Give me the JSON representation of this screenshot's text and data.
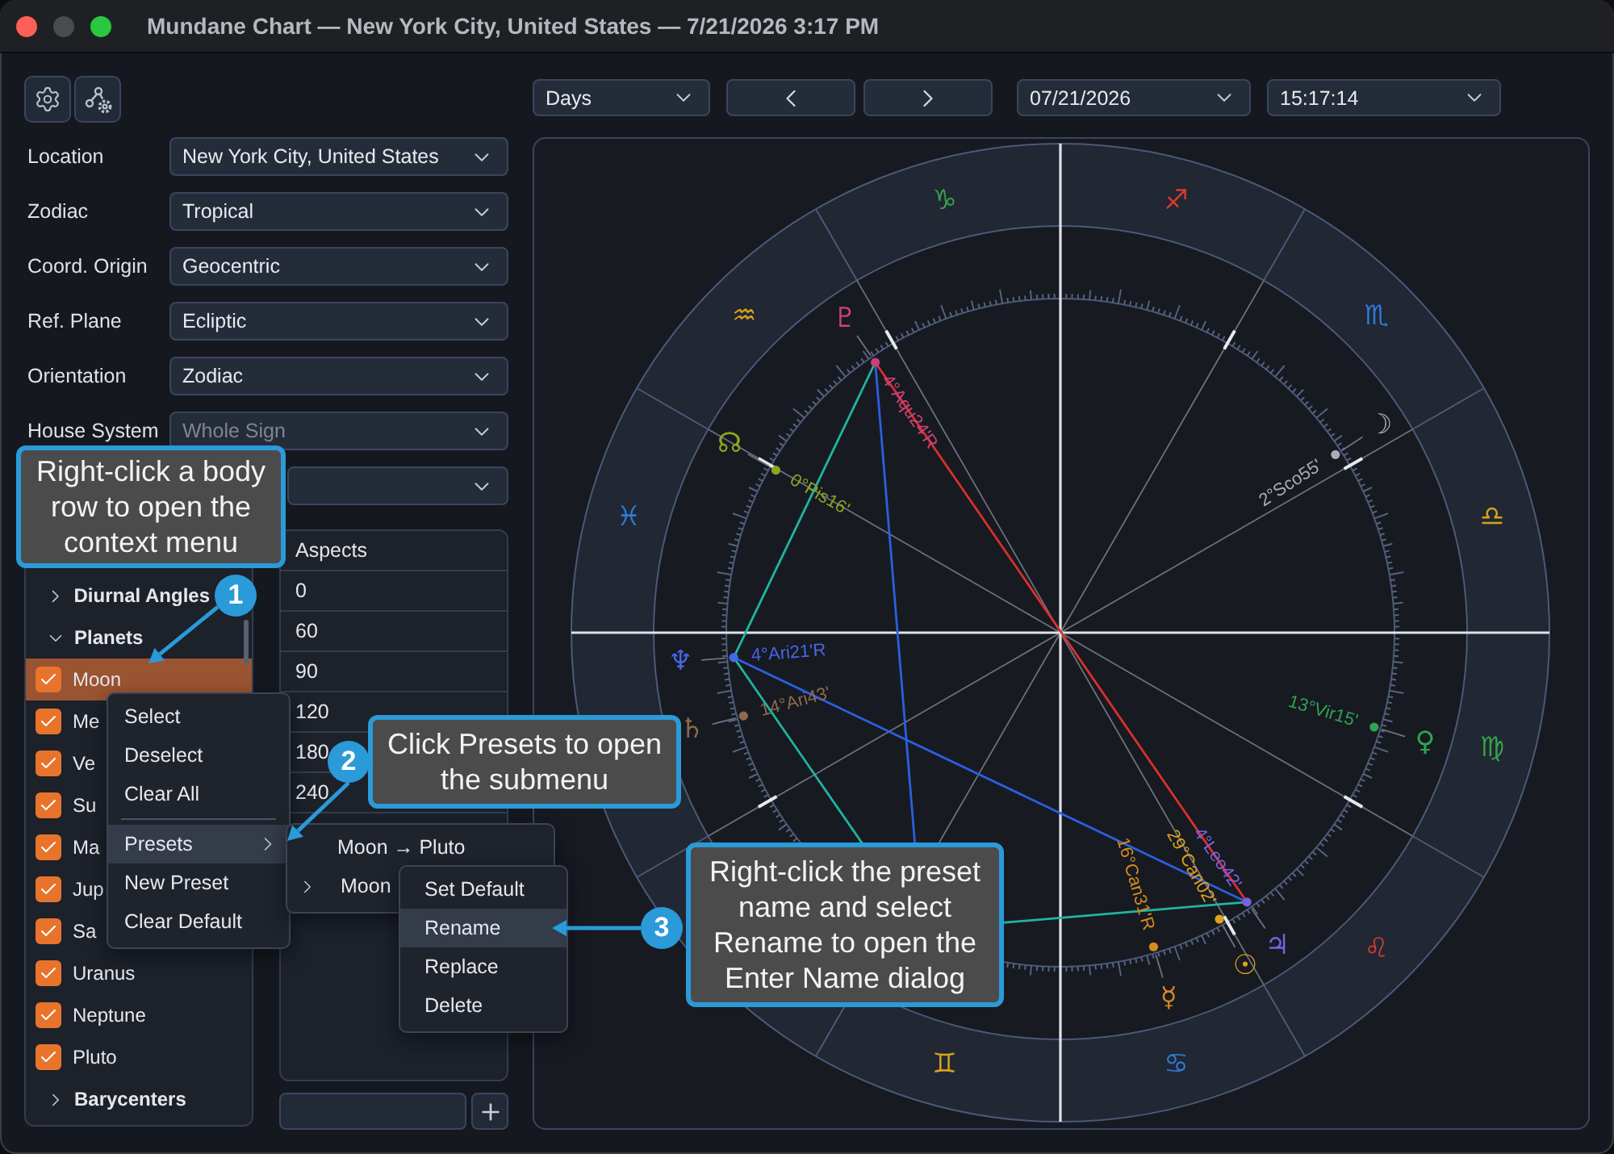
{
  "window": {
    "title": "Mundane Chart — New York City, United States — 7/21/2026 3:17 PM",
    "controls": [
      {
        "kind": "close",
        "disabled": false
      },
      {
        "kind": "minimize",
        "disabled": true
      },
      {
        "kind": "zoom",
        "disabled": false
      }
    ]
  },
  "tool_buttons": [
    {
      "kind": "settings"
    },
    {
      "kind": "chart_settings"
    }
  ],
  "settings_fields": [
    {
      "label": "Location",
      "value": "New York City, United States",
      "disabled": false
    },
    {
      "label": "Zodiac",
      "value": "Tropical",
      "disabled": false
    },
    {
      "label": "Coord. Origin",
      "value": "Geocentric",
      "disabled": false
    },
    {
      "label": "Ref. Plane",
      "value": "Ecliptic",
      "disabled": false
    },
    {
      "label": "Orientation",
      "value": "Zodiac",
      "disabled": false
    },
    {
      "label": "House System",
      "value": "Whole Sign",
      "disabled": true
    }
  ],
  "bodies_list": [
    {
      "label": "Diurnal Angles",
      "expanded": false,
      "selected": false
    },
    {
      "label": "Planets",
      "expanded": true,
      "selected": false,
      "children": [
        {
          "label": "Moon",
          "checked": true,
          "selected": true
        },
        {
          "label": "Me",
          "checked": true,
          "selected": false
        },
        {
          "label": "Ve",
          "checked": true,
          "selected": false
        },
        {
          "label": "Su",
          "checked": true,
          "selected": false
        },
        {
          "label": "Ma",
          "checked": true,
          "selected": false
        },
        {
          "label": "Jup",
          "checked": true,
          "selected": false
        },
        {
          "label": "Sa",
          "checked": true,
          "selected": false
        },
        {
          "label": "Uranus",
          "checked": true,
          "selected": false
        },
        {
          "label": "Neptune",
          "checked": true,
          "selected": false
        },
        {
          "label": "Pluto",
          "checked": true,
          "selected": false
        }
      ]
    },
    {
      "label": "Barycenters",
      "expanded": false,
      "selected": false
    }
  ],
  "aspects_panel": {
    "header": "Aspects",
    "rows": [
      "0",
      "60",
      "90",
      "120",
      "180",
      "240"
    ]
  },
  "time_bar": {
    "step": "Days",
    "nav_buttons": [
      {
        "kind": "previous"
      },
      {
        "kind": "next"
      }
    ],
    "date": "07/21/2026",
    "time": "15:17:14"
  },
  "chart": {
    "signs": [
      {
        "glyph": "♊",
        "color": "#d6a11f"
      },
      {
        "glyph": "♋",
        "color": "#2f7ad6"
      },
      {
        "glyph": "♌",
        "color": "#d63b30"
      },
      {
        "glyph": "♍",
        "color": "#35a04a"
      },
      {
        "glyph": "♎",
        "color": "#d6a11f"
      },
      {
        "glyph": "♏",
        "color": "#2f7ad6"
      },
      {
        "glyph": "♐",
        "color": "#d63b30"
      },
      {
        "glyph": "♑",
        "color": "#35a04a"
      },
      {
        "glyph": "♒",
        "color": "#d6a11f"
      },
      {
        "glyph": "♓",
        "color": "#2f7ad6"
      }
    ],
    "bodies": [
      {
        "glyph": "♇",
        "position": "4°Aqu24'R",
        "color": "#c8437a"
      },
      {
        "glyph": "☽",
        "position": "2°Sco55'",
        "color": "#a9adb6"
      },
      {
        "glyph": "☊",
        "position": "0°Pis16'",
        "color": "#8fa41e"
      },
      {
        "glyph": "♆",
        "position": "4°Ari21'R",
        "color": "#4767e6"
      },
      {
        "glyph": "♄",
        "position": "14°Ari43'",
        "color": "#8d6b4c"
      },
      {
        "glyph": "♀",
        "position": "13°Vir15'",
        "color": "#2fa352"
      },
      {
        "glyph": "♃",
        "position": "4°Leo42'",
        "color": "#7b60e2"
      },
      {
        "glyph": "☉",
        "position": "29°Can02'",
        "color": "#dfa11f"
      },
      {
        "glyph": "☿",
        "position": "16°Can31'R",
        "color": "#d68b1c"
      }
    ]
  },
  "context_menu": {
    "items": [
      {
        "kind": "item",
        "label": "Select",
        "selected": false
      },
      {
        "kind": "item",
        "label": "Deselect",
        "selected": false
      },
      {
        "kind": "item",
        "label": "Clear All",
        "selected": false
      },
      {
        "kind": "separator"
      },
      {
        "kind": "submenu",
        "label": "Presets",
        "selected": true
      },
      {
        "kind": "item",
        "label": "New Preset",
        "selected": false
      },
      {
        "kind": "item",
        "label": "Clear Default",
        "selected": false
      }
    ]
  },
  "presets_submenu": {
    "items": [
      {
        "kind": "preset",
        "label": "Moon → Pluto",
        "selected": false
      },
      {
        "kind": "folder",
        "label": "Moon",
        "selected": false
      }
    ]
  },
  "preset_menu": {
    "items": [
      {
        "label": "Set Default",
        "selected": false
      },
      {
        "label": "Rename",
        "selected": true
      },
      {
        "label": "Replace",
        "selected": false
      },
      {
        "label": "Delete",
        "selected": false
      }
    ]
  },
  "callouts": [
    {
      "number": "1",
      "text": "Right-click a body row to open the context menu"
    },
    {
      "number": "2",
      "text": "Click Presets to open the submenu"
    },
    {
      "number": "3",
      "text": "Right-click the preset name and select Rename to open the Enter Name dialog"
    }
  ]
}
